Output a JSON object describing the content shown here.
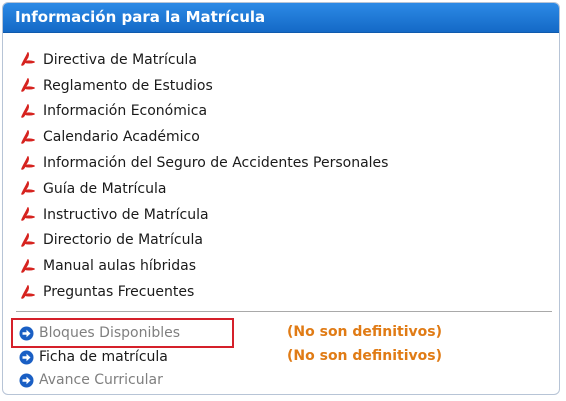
{
  "panel": {
    "title": "Información para la Matrícula",
    "header_color": "#1a74d4"
  },
  "documents": [
    {
      "label": "Directiva de Matrícula",
      "icon": "pdf-icon"
    },
    {
      "label": "Reglamento de Estudios",
      "icon": "pdf-icon"
    },
    {
      "label": "Información Económica",
      "icon": "pdf-icon"
    },
    {
      "label": "Calendario Académico",
      "icon": "pdf-icon"
    },
    {
      "label": "Información del Seguro de Accidentes Personales",
      "icon": "pdf-icon"
    },
    {
      "label": "Guía de Matrícula",
      "icon": "pdf-icon"
    },
    {
      "label": "Instructivo de Matrícula",
      "icon": "pdf-icon"
    },
    {
      "label": "Directorio de Matrícula",
      "icon": "pdf-icon"
    },
    {
      "label": "Manual aulas híbridas",
      "icon": "pdf-icon"
    },
    {
      "label": "Preguntas Frecuentes",
      "icon": "pdf-icon"
    }
  ],
  "links": [
    {
      "label": "Bloques Disponibles",
      "icon": "arrow-right-circle-icon",
      "note": "(No son definitivos)",
      "style": "muted",
      "highlighted": true
    },
    {
      "label": "Ficha de matrícula",
      "icon": "arrow-right-circle-icon",
      "note": "(No son definitivos)",
      "style": "dark",
      "highlighted": false
    },
    {
      "label": "Avance Curricular",
      "icon": "arrow-right-circle-icon",
      "note": "",
      "style": "muted",
      "highlighted": false
    }
  ],
  "colors": {
    "accent": "#1a74d4",
    "note": "#e07b15",
    "highlight": "#d5202a",
    "pdf_icon": "#d6231f"
  }
}
